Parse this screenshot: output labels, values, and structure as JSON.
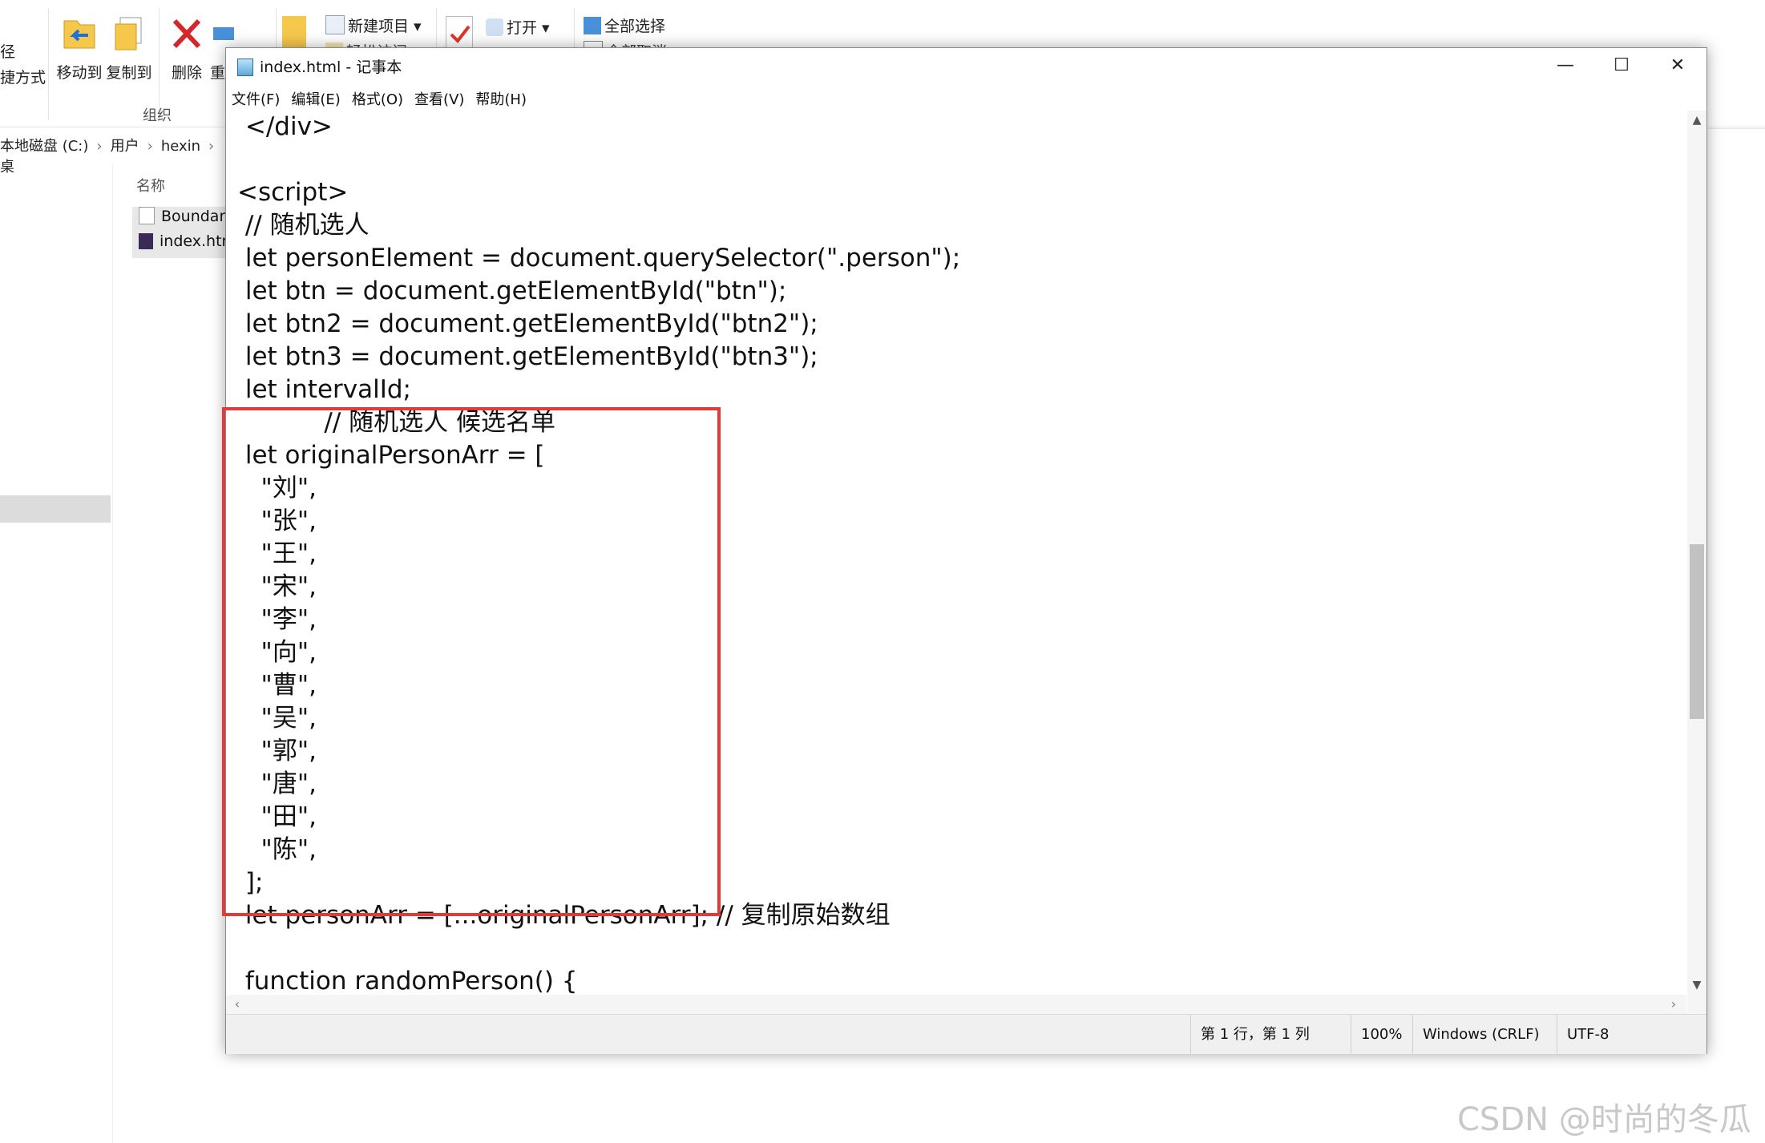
{
  "explorer": {
    "cut_left_top": "径",
    "cut_left_bottom": "捷方式",
    "ribbon_buttons": {
      "move_to": "移动到",
      "copy_to": "复制到",
      "delete": "删除",
      "rename_cut": "重"
    },
    "ribbon_small": {
      "new_item": "新建项目",
      "easy_access_cut": "轻松访问",
      "open": "打开",
      "select_all": "全部选择",
      "select_none_cut": "全部取消"
    },
    "group_label": "组织",
    "breadcrumb": [
      "本地磁盘 (C:)",
      "用户",
      "hexin",
      "桌"
    ],
    "column_header": "名称",
    "files": [
      "BoundaryPractice",
      "index.html"
    ]
  },
  "notepad": {
    "title": "index.html - 记事本",
    "window_controls": {
      "minimize": "—",
      "maximize": "☐",
      "close": "✕"
    },
    "menu": [
      "文件(F)",
      "编辑(E)",
      "格式(O)",
      "查看(V)",
      "帮助(H)"
    ],
    "editor_text": " </div>\n\n<script>\n // 随机选人\n let personElement = document.querySelector(\".person\");\n let btn = document.getElementById(\"btn\");\n let btn2 = document.getElementById(\"btn2\");\n let btn3 = document.getElementById(\"btn3\");\n let intervalId;\n           // 随机选人 候选名单\n let originalPersonArr = [\n   \"刘\",\n   \"张\",\n   \"王\",\n   \"宋\",\n   \"李\",\n   \"向\",\n   \"曹\",\n   \"吴\",\n   \"郭\",\n   \"唐\",\n   \"田\",\n   \"陈\",\n ];\n let personArr = [...originalPersonArr]; // 复制原始数组\n\n function randomPerson() {\n   if (intervalId) return; // 防止重复点击",
    "status": {
      "position": "第 1 行，第 1 列",
      "zoom": "100%",
      "line_ending": "Windows (CRLF)",
      "encoding": "UTF-8"
    }
  },
  "watermark": "CSDN @时尚的冬瓜"
}
